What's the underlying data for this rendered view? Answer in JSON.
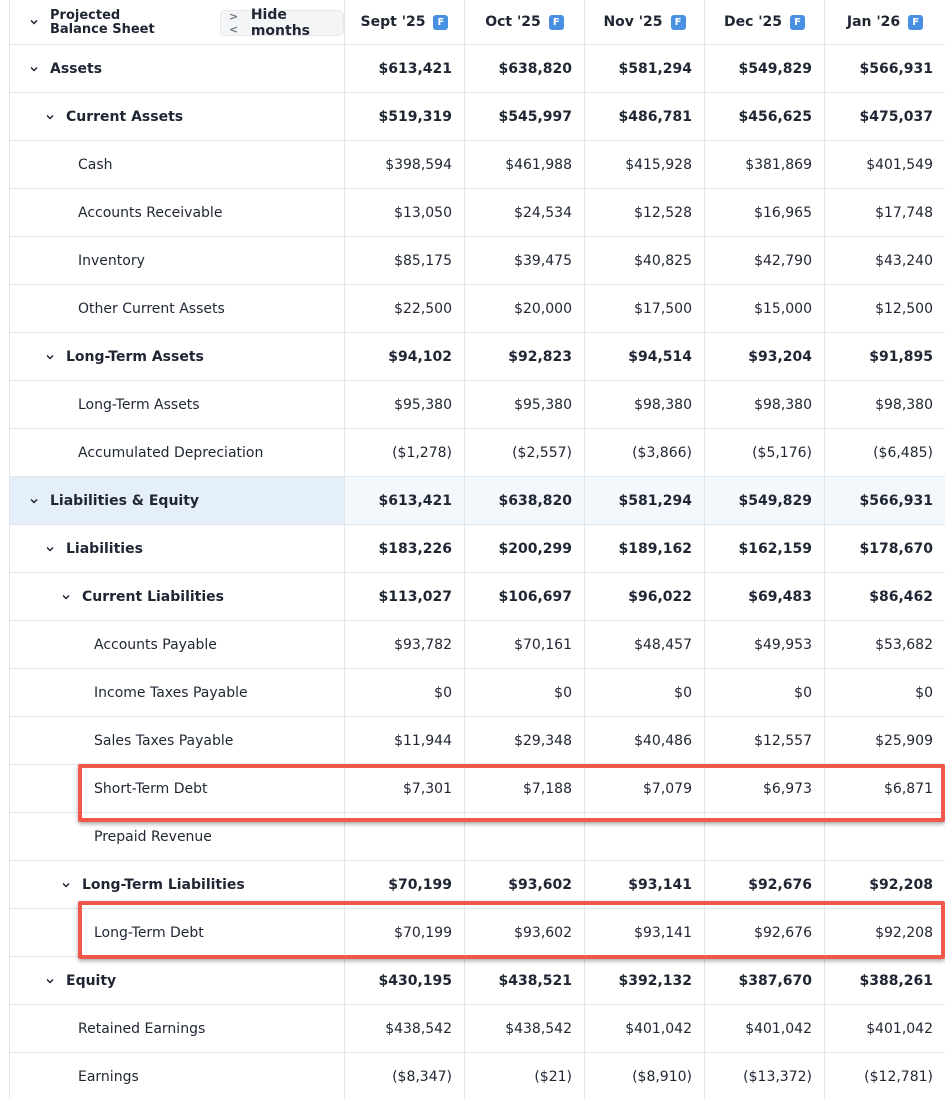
{
  "header": {
    "title_line1": "Projected",
    "title_line2": "Balance Sheet",
    "hide_months": "Hide months",
    "months": [
      {
        "label": "Sept '25",
        "badge": "F"
      },
      {
        "label": "Oct '25",
        "badge": "F"
      },
      {
        "label": "Nov '25",
        "badge": "F"
      },
      {
        "label": "Dec '25",
        "badge": "F"
      },
      {
        "label": "Jan '26",
        "badge": "F"
      }
    ]
  },
  "rows": [
    {
      "label": "Assets",
      "values": [
        "$613,421",
        "$638,820",
        "$581,294",
        "$549,829",
        "$566,931"
      ]
    },
    {
      "label": "Current Assets",
      "values": [
        "$519,319",
        "$545,997",
        "$486,781",
        "$456,625",
        "$475,037"
      ]
    },
    {
      "label": "Cash",
      "values": [
        "$398,594",
        "$461,988",
        "$415,928",
        "$381,869",
        "$401,549"
      ]
    },
    {
      "label": "Accounts Receivable",
      "values": [
        "$13,050",
        "$24,534",
        "$12,528",
        "$16,965",
        "$17,748"
      ]
    },
    {
      "label": "Inventory",
      "values": [
        "$85,175",
        "$39,475",
        "$40,825",
        "$42,790",
        "$43,240"
      ]
    },
    {
      "label": "Other Current Assets",
      "values": [
        "$22,500",
        "$20,000",
        "$17,500",
        "$15,000",
        "$12,500"
      ]
    },
    {
      "label": "Long-Term Assets",
      "values": [
        "$94,102",
        "$92,823",
        "$94,514",
        "$93,204",
        "$91,895"
      ]
    },
    {
      "label": "Long-Term Assets",
      "values": [
        "$95,380",
        "$95,380",
        "$98,380",
        "$98,380",
        "$98,380"
      ]
    },
    {
      "label": "Accumulated Depreciation",
      "values": [
        "($1,278)",
        "($2,557)",
        "($3,866)",
        "($5,176)",
        "($6,485)"
      ]
    },
    {
      "label": "Liabilities & Equity",
      "values": [
        "$613,421",
        "$638,820",
        "$581,294",
        "$549,829",
        "$566,931"
      ]
    },
    {
      "label": "Liabilities",
      "values": [
        "$183,226",
        "$200,299",
        "$189,162",
        "$162,159",
        "$178,670"
      ]
    },
    {
      "label": "Current Liabilities",
      "values": [
        "$113,027",
        "$106,697",
        "$96,022",
        "$69,483",
        "$86,462"
      ]
    },
    {
      "label": "Accounts Payable",
      "values": [
        "$93,782",
        "$70,161",
        "$48,457",
        "$49,953",
        "$53,682"
      ]
    },
    {
      "label": "Income Taxes Payable",
      "values": [
        "$0",
        "$0",
        "$0",
        "$0",
        "$0"
      ]
    },
    {
      "label": "Sales Taxes Payable",
      "values": [
        "$11,944",
        "$29,348",
        "$40,486",
        "$12,557",
        "$25,909"
      ]
    },
    {
      "label": "Short-Term Debt",
      "values": [
        "$7,301",
        "$7,188",
        "$7,079",
        "$6,973",
        "$6,871"
      ]
    },
    {
      "label": "Prepaid Revenue",
      "values": [
        "",
        "",
        "",
        "",
        ""
      ]
    },
    {
      "label": "Long-Term Liabilities",
      "values": [
        "$70,199",
        "$93,602",
        "$93,141",
        "$92,676",
        "$92,208"
      ]
    },
    {
      "label": "Long-Term Debt",
      "values": [
        "$70,199",
        "$93,602",
        "$93,141",
        "$92,676",
        "$92,208"
      ]
    },
    {
      "label": "Equity",
      "values": [
        "$430,195",
        "$438,521",
        "$392,132",
        "$387,670",
        "$388,261"
      ]
    },
    {
      "label": "Retained Earnings",
      "values": [
        "$438,542",
        "$438,542",
        "$401,042",
        "$401,042",
        "$401,042"
      ]
    },
    {
      "label": "Earnings",
      "values": [
        "($8,347)",
        "($21)",
        "($8,910)",
        "($13,372)",
        "($12,781)"
      ]
    }
  ],
  "colors": {
    "accent": "#4a90e2",
    "highlight_box": "#f1584b",
    "selected_row": "#e4effb"
  }
}
